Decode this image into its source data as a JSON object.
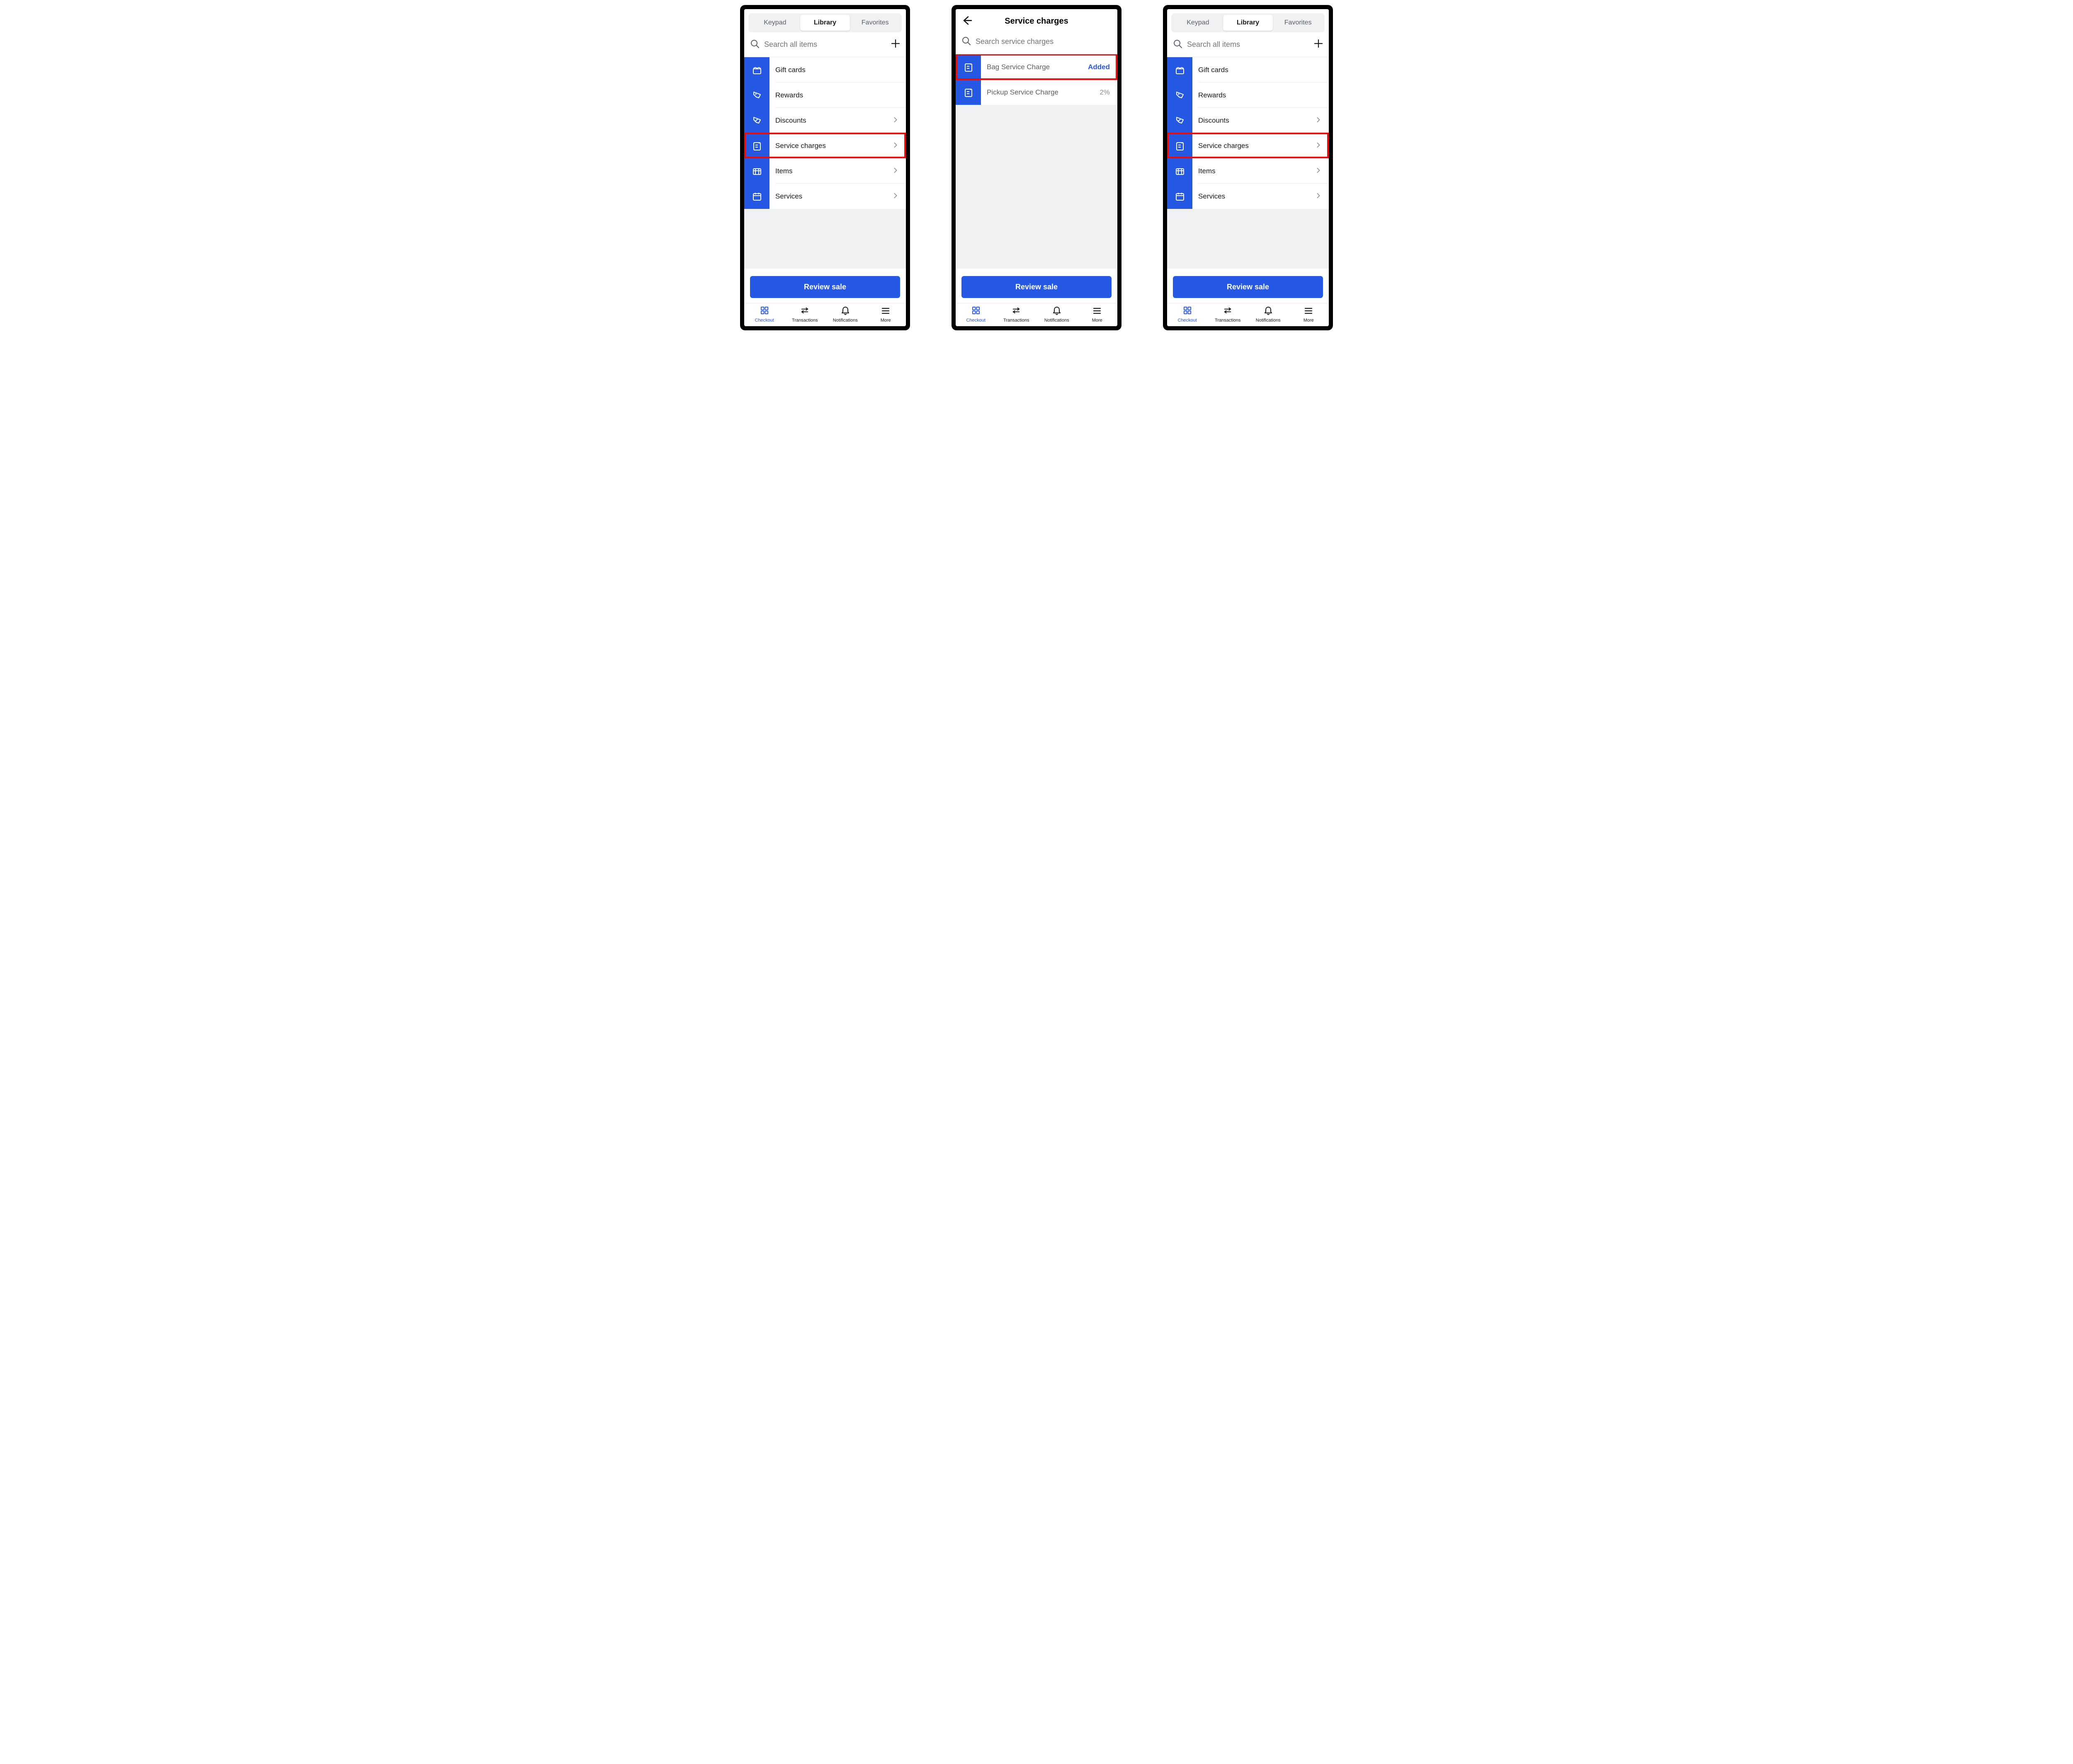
{
  "tabs": {
    "keypad": "Keypad",
    "library": "Library",
    "favorites": "Favorites"
  },
  "search": {
    "all_items": "Search all items",
    "service_charges": "Search service charges"
  },
  "library": {
    "gift_cards": "Gift cards",
    "rewards": "Rewards",
    "discounts": "Discounts",
    "service_charges": "Service charges",
    "items": "Items",
    "services": "Services"
  },
  "service_charges_screen": {
    "title": "Service charges",
    "row1_label": "Bag Service Charge",
    "row1_status": "Added",
    "row2_label": "Pickup Service Charge",
    "row2_value": "2%"
  },
  "actions": {
    "review_sale": "Review sale"
  },
  "nav": {
    "checkout": "Checkout",
    "transactions": "Transactions",
    "notifications": "Notifications",
    "more": "More"
  },
  "colors": {
    "primary": "#2559e4",
    "highlight": "#e90e0e"
  }
}
